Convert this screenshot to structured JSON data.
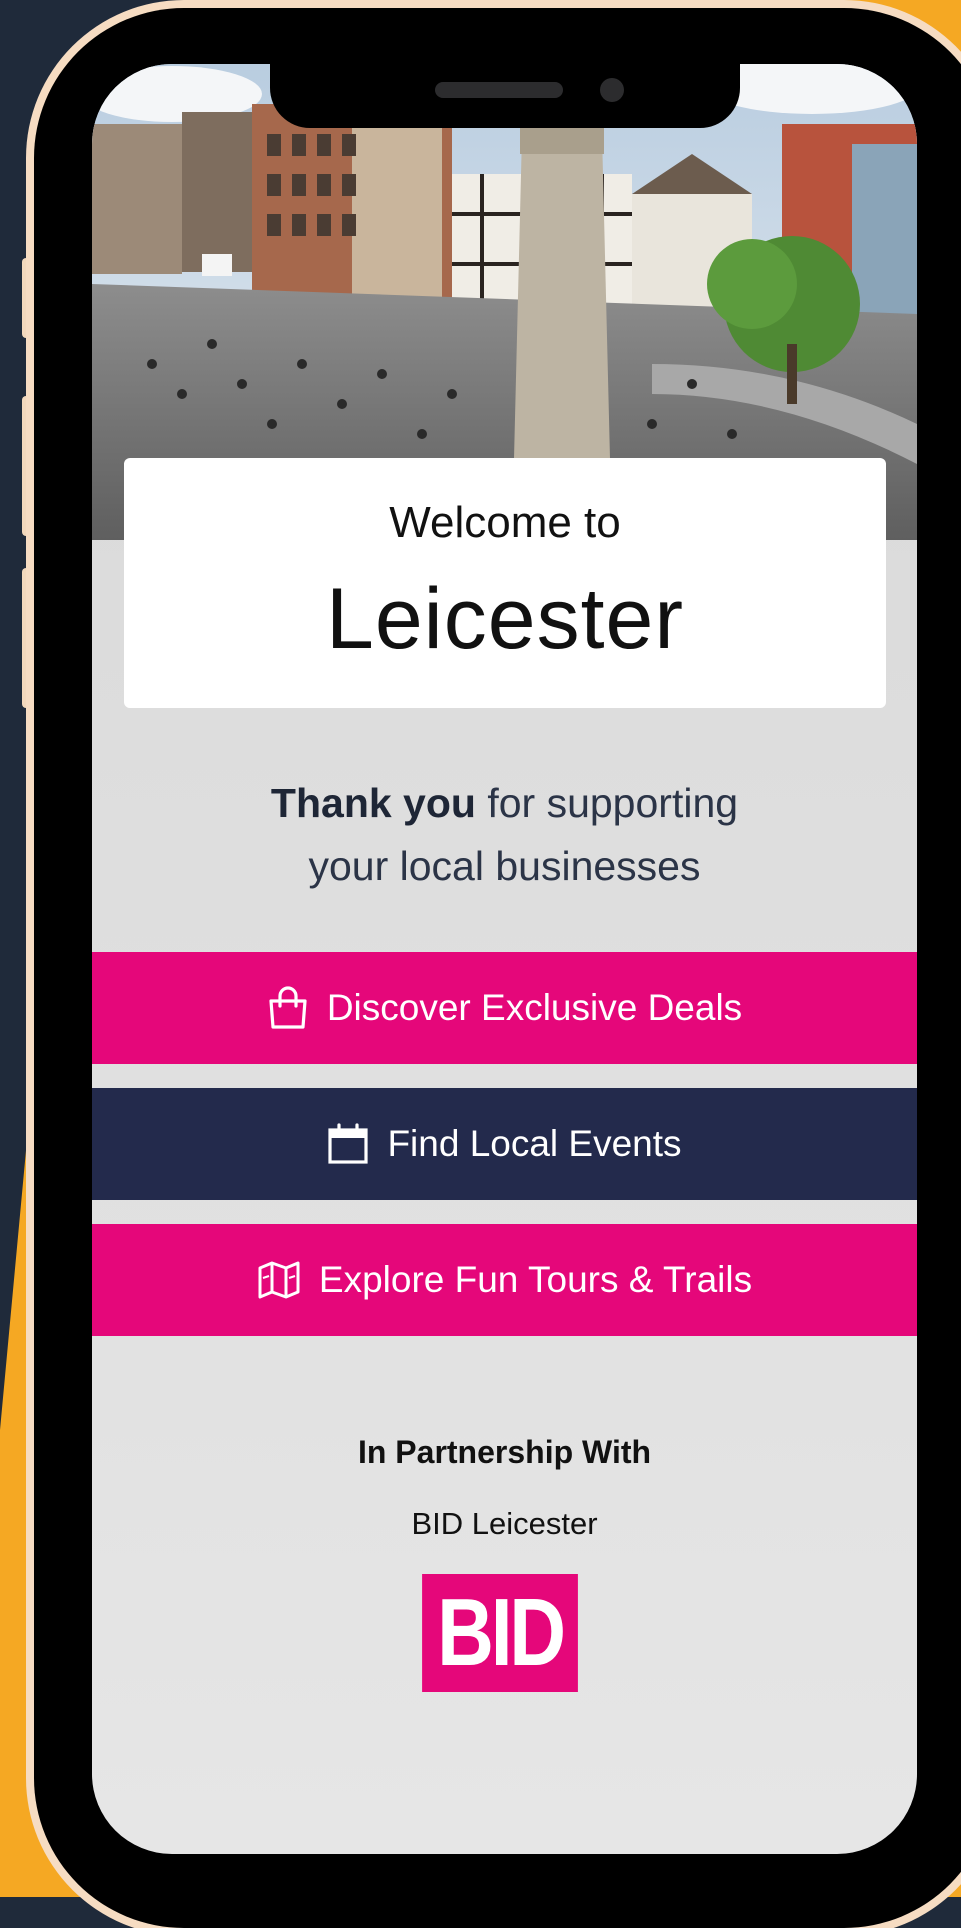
{
  "colors": {
    "background_navy": "#1f2a3a",
    "background_yellow": "#f5a823",
    "phone_frame": "#000000",
    "accent_pink": "#e5077a",
    "accent_navy": "#232a4c"
  },
  "welcome": {
    "line1": "Welcome to",
    "city": "Leicester"
  },
  "thanks": {
    "bold": "Thank you",
    "rest": " for supporting",
    "line2": "your local businesses"
  },
  "buttons": [
    {
      "label": "Discover Exclusive Deals",
      "icon": "shopping-bag-icon"
    },
    {
      "label": "Find Local Events",
      "icon": "calendar-icon"
    },
    {
      "label": "Explore Fun Tours & Trails",
      "icon": "map-icon"
    }
  ],
  "partner": {
    "heading": "In Partnership With",
    "name": "BID Leicester",
    "logo_text": "BID"
  }
}
